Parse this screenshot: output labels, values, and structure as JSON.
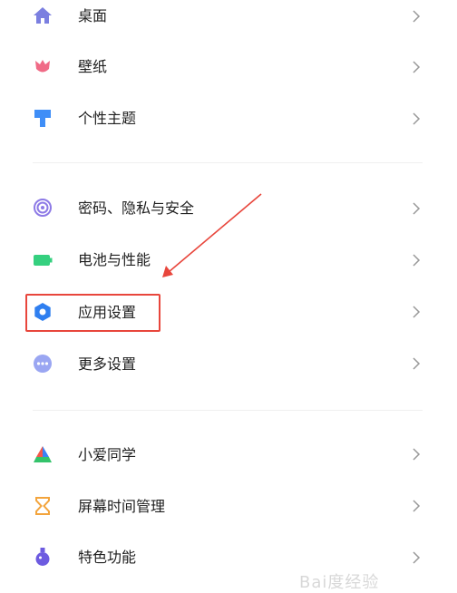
{
  "settings": {
    "items": [
      {
        "label": "桌面",
        "icon": "home-icon"
      },
      {
        "label": "壁纸",
        "icon": "tulip-icon"
      },
      {
        "label": "个性主题",
        "icon": "brush-icon"
      },
      {
        "label": "密码、隐私与安全",
        "icon": "fingerprint-icon"
      },
      {
        "label": "电池与性能",
        "icon": "battery-icon"
      },
      {
        "label": "应用设置",
        "icon": "gear-icon"
      },
      {
        "label": "更多设置",
        "icon": "more-dots-icon"
      },
      {
        "label": "小爱同学",
        "icon": "xiaoai-icon"
      },
      {
        "label": "屏幕时间管理",
        "icon": "hourglass-icon"
      },
      {
        "label": "特色功能",
        "icon": "flask-icon"
      }
    ]
  },
  "annotation": {
    "highlight_color": "#e8463c"
  },
  "watermark": {
    "text": "Bai度经验"
  },
  "colors": {
    "home": "#7b7fe0",
    "wallpaper": "#f06a86",
    "theme": "#3f8ef7",
    "privacy": "#8d7ae6",
    "battery": "#35d07f",
    "app_settings": "#2f7ff0",
    "more": "#9aa6f2",
    "hourglass": "#f3a43c",
    "flask": "#6d5be0"
  }
}
